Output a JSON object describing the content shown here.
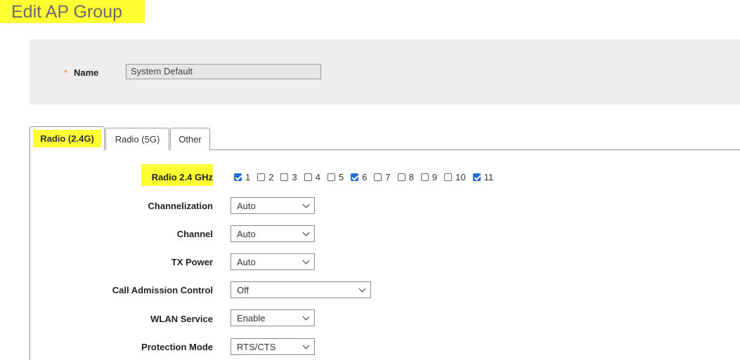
{
  "page": {
    "title": "Edit AP Group"
  },
  "name_field": {
    "required_marker": "*",
    "label": "Name",
    "value": "System Default"
  },
  "tabs": [
    {
      "label": "Radio (2.4G)",
      "active": true
    },
    {
      "label": "Radio (5G)",
      "active": false
    },
    {
      "label": "Other",
      "active": false
    }
  ],
  "radio24": {
    "label": "Radio 2.4 GHz",
    "channels": [
      {
        "label": "1",
        "checked": true
      },
      {
        "label": "2",
        "checked": false
      },
      {
        "label": "3",
        "checked": false
      },
      {
        "label": "4",
        "checked": false
      },
      {
        "label": "5",
        "checked": false
      },
      {
        "label": "6",
        "checked": true
      },
      {
        "label": "7",
        "checked": false
      },
      {
        "label": "8",
        "checked": false
      },
      {
        "label": "9",
        "checked": false
      },
      {
        "label": "10",
        "checked": false
      },
      {
        "label": "11",
        "checked": true
      }
    ]
  },
  "settings": {
    "channelization": {
      "label": "Channelization",
      "value": "Auto"
    },
    "channel": {
      "label": "Channel",
      "value": "Auto"
    },
    "tx_power": {
      "label": "TX Power",
      "value": "Auto"
    },
    "call_admission": {
      "label": "Call Admission Control",
      "value": "Off"
    },
    "wlan_service": {
      "label": "WLAN Service",
      "value": "Enable"
    },
    "protection_mode": {
      "label": "Protection Mode",
      "value": "RTS/CTS"
    }
  },
  "colors": {
    "highlight": "#ffff33",
    "accent": "#1f6fd6",
    "panel": "#efedef"
  }
}
